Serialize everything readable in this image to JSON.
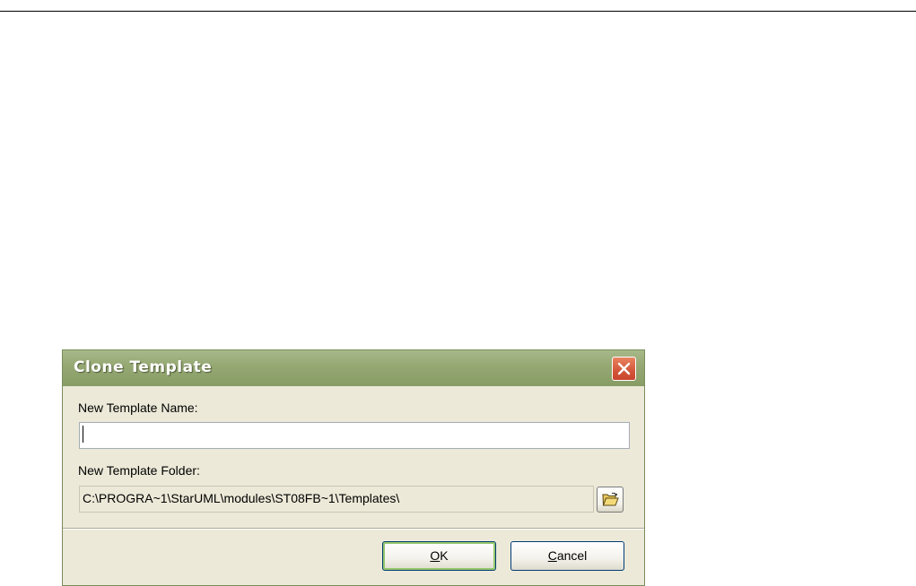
{
  "dialog": {
    "title": "Clone Template",
    "close_icon": "close-icon",
    "name_label": "New Template Name:",
    "name_value": "",
    "folder_label": "New Template Folder:",
    "folder_value": "C:\\PROGRA~1\\StarUML\\modules\\ST08FB~1\\Templates\\",
    "browse_icon": "open-folder-icon",
    "ok": {
      "mnemonic": "O",
      "rest": "K"
    },
    "cancel": {
      "mnemonic": "C",
      "rest": "ancel"
    }
  },
  "colors": {
    "titlebar": "#96a974",
    "dialog_bg": "#ece9d8",
    "close_button": "#d3553a",
    "default_button_ring": "#96c76d"
  }
}
